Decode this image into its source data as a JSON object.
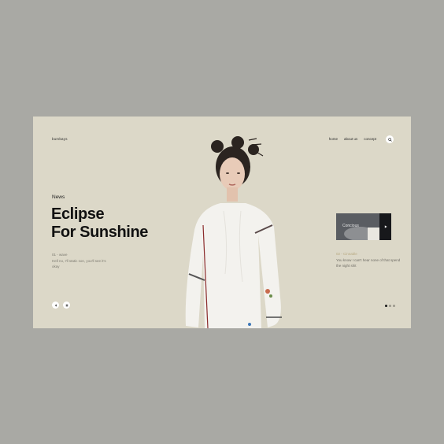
{
  "brand": {
    "name": "bumbays"
  },
  "nav": {
    "items": [
      "home",
      "about us",
      "concept"
    ]
  },
  "hero": {
    "tag": "News",
    "headline_line1": "Eclipse",
    "headline_line2": "For Sunshine",
    "meta": "01 - wave",
    "description": "Hell no, I'll static son, you'll see it's okay"
  },
  "side": {
    "thumb_label": "Concious",
    "meta": "02 - Cinnable",
    "description": "You know I can't hear none of that spend the night shit"
  },
  "slider": {
    "dots": 3,
    "active_dot": 1
  },
  "colors": {
    "page_bg": "#a9a9a4",
    "card_bg": "#dcd8c8",
    "text": "#111111",
    "accent_meta": "#b8a980"
  },
  "icons": {
    "search": "search-icon",
    "prev": "arrow-left-icon",
    "next": "pause-icon",
    "play": "play-icon"
  }
}
